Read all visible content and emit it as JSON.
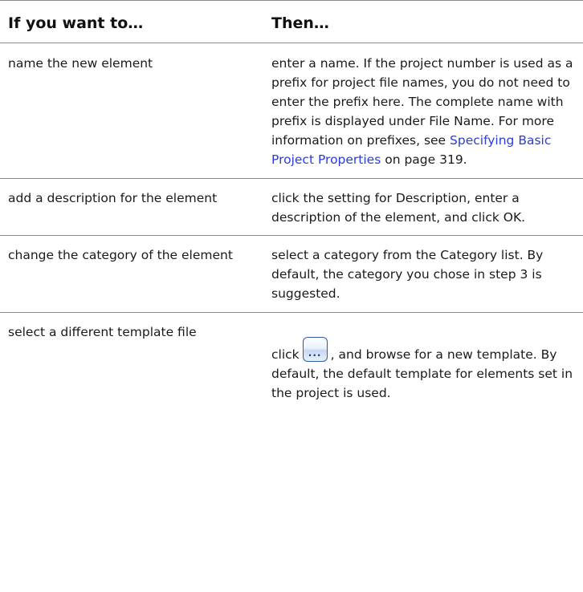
{
  "table": {
    "header": {
      "col1": "If you want to…",
      "col2": "Then…"
    },
    "rows": [
      {
        "col1": "name the new element",
        "col2_before_link": "enter a name. If the project number is used as a prefix for project file names, you do not need to enter the prefix here. The complete name with prefix is displayed under File Name. For more information on prefixes, see ",
        "col2_link": "Specifying Basic Project Properties",
        "col2_after_link": " on page 319."
      },
      {
        "col1": "add a description for the element",
        "col2": "click the setting for Description, enter a description of the element, and click OK."
      },
      {
        "col1": "change the category of the element",
        "col2": "select a category from the Category list. By default, the category you chose in step 3 is suggested."
      },
      {
        "col1": "select a different template file",
        "col2_before_icon": "click",
        "col2_icon": "browse-button-icon",
        "col2_icon_glyph": "...",
        "col2_after_icon": ", and browse for a new template. By default, the default template for elements set in the project is used."
      }
    ]
  },
  "colors": {
    "link": "#2a3cd6",
    "rule": "#8a8a8a",
    "text": "#1a1a1a"
  }
}
